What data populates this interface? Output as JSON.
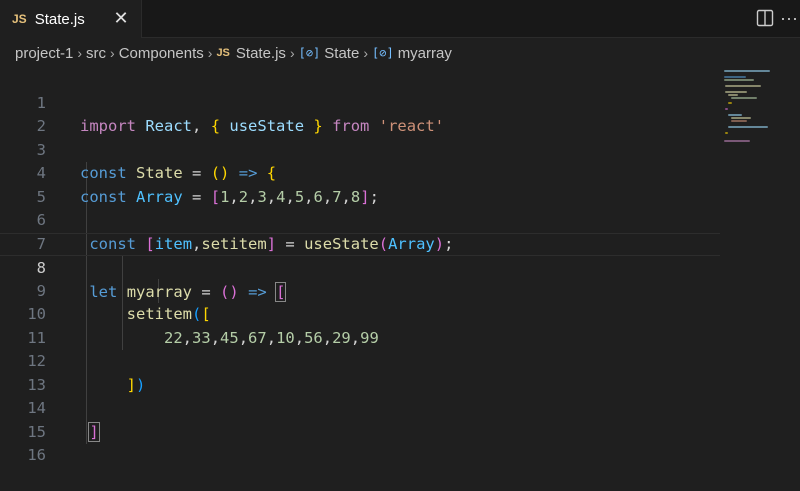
{
  "tab": {
    "badge": "JS",
    "filename": "State.js",
    "close_glyph": "✕"
  },
  "toolbar": {
    "split_icon": "split-editor-icon",
    "more_glyph": "···"
  },
  "breadcrumb": {
    "items": [
      "project-1",
      "src",
      "Components",
      "State.js",
      "State",
      "myarray"
    ],
    "file_badge": "JS",
    "symbol_glyph": "[⊘]"
  },
  "editor": {
    "active_line": 8,
    "line_numbers": [
      "1",
      "2",
      "3",
      "4",
      "5",
      "6",
      "7",
      "8",
      "9",
      "10",
      "11",
      "12",
      "13",
      "14",
      "15",
      "16"
    ]
  },
  "colors": {
    "background": "#1f1f1f",
    "keyword": "#569cd6",
    "control_keyword": "#c586c0",
    "variable": "#9cdcfe",
    "function": "#dcdcaa",
    "string": "#ce9178",
    "number": "#b5cea8",
    "bracket_level1": "#ffd700",
    "bracket_level2": "#da70d6",
    "bracket_level3": "#179fff"
  }
}
